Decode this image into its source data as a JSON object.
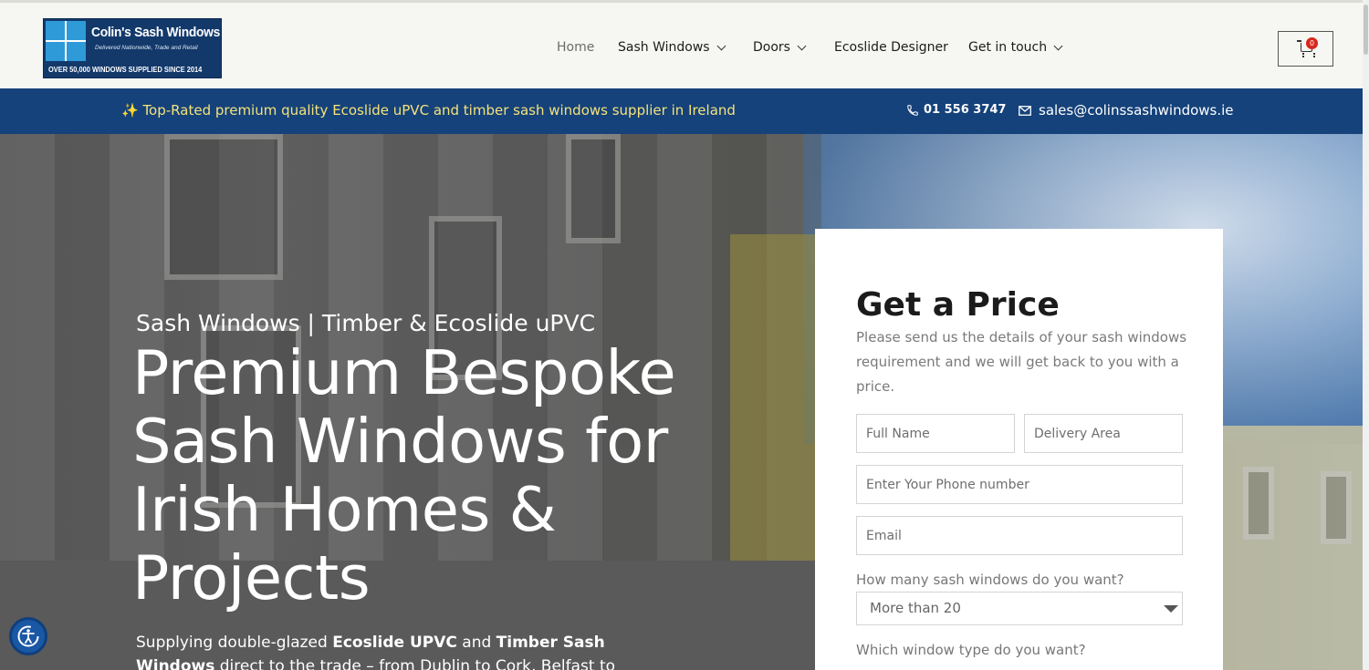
{
  "logo": {
    "name": "Colin's Sash Windows",
    "tagline": "Delivered Nationwide, Trade and Retail",
    "banner": "OVER 50,000 WINDOWS SUPPLIED SINCE 2014"
  },
  "nav": {
    "items": [
      {
        "label": "Home"
      },
      {
        "label": "Sash Windows"
      },
      {
        "label": "Doors"
      },
      {
        "label": "Ecoslide Designer"
      },
      {
        "label": "Get in touch"
      }
    ]
  },
  "cart": {
    "count": "0"
  },
  "topbar": {
    "message": "✨ Top-Rated premium quality Ecoslide uPVC and timber sash windows supplier in Ireland",
    "phone": "01 556 3747",
    "email": "sales@colinssashwindows.ie"
  },
  "hero": {
    "subtitle": "Sash Windows | Timber & Ecoslide uPVC",
    "title": "Premium Bespoke Sash Windows for Irish Homes & Projects",
    "desc_prefix": "Supplying double-glazed ",
    "desc_bold1": "Ecoslide UPVC",
    "desc_mid": " and ",
    "desc_bold2": "Timber Sash Windows",
    "desc_suffix": " direct to the trade – from Dublin to Cork, Belfast to"
  },
  "form": {
    "title": "Get a Price",
    "description": "Please send us the details of your sash windows requirement and we will get back to you with a price.",
    "full_name_placeholder": "Full Name",
    "delivery_area_placeholder": "Delivery Area",
    "phone_placeholder": "Enter Your Phone number",
    "email_placeholder": "Email",
    "quantity_label": "How many sash windows do you want?",
    "quantity_value": "More than 20",
    "type_label": "Which window type do you want?"
  }
}
